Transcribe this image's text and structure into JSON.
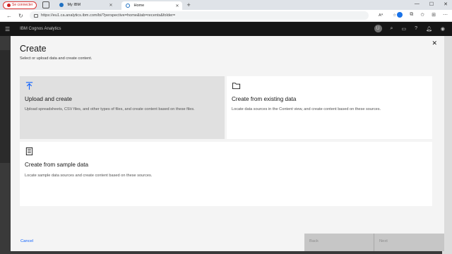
{
  "browser": {
    "profile_label": "Se connecter",
    "tabs": [
      {
        "label": "My IBM"
      },
      {
        "label": "Home"
      }
    ],
    "new_tab": "+",
    "url": "https://eu1.ca.analytics.ibm.com/bi/?perspective=home&tab=recents&folder=",
    "reader_label": "Aᴬ"
  },
  "app": {
    "brand": "IBM Cognos Analytics",
    "avatar_initials": "U"
  },
  "modal": {
    "title": "Create",
    "subtitle": "Select or upload data and create content.",
    "cards": [
      {
        "title": "Upload and create",
        "description": "Upload spreadsheets, CSV files, and other types of files, and create content based on these files.",
        "icon": "upload-icon",
        "selected": true
      },
      {
        "title": "Create from existing data",
        "description": "Locate data sources in the Content view, and create content based on these sources.",
        "icon": "folder-icon",
        "selected": false
      },
      {
        "title": "Create from sample data",
        "description": "Locate sample data sources and create content based on these sources.",
        "icon": "list-document-icon",
        "selected": false
      }
    ],
    "footer": {
      "cancel": "Cancel",
      "back": "Back",
      "next": "Next"
    }
  },
  "colors": {
    "accent": "#0f62fe",
    "header_bg": "#161616",
    "selected_card": "#e0e0e0"
  }
}
